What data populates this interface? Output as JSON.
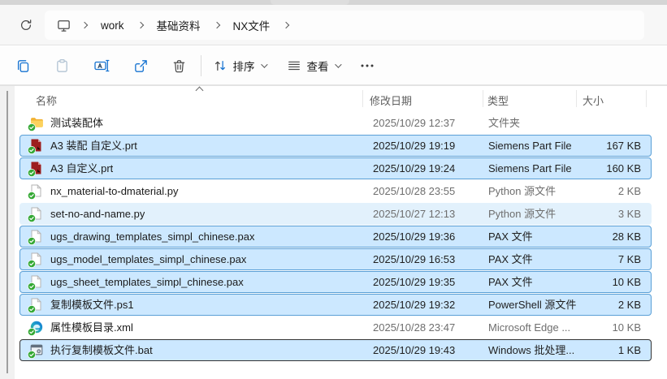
{
  "breadcrumb": {
    "items": [
      "work",
      "基础资料",
      "NX文件"
    ]
  },
  "toolbar": {
    "buttons": [
      "copy",
      "paste",
      "rename",
      "share",
      "delete"
    ],
    "sort_label": "排序",
    "view_label": "查看",
    "more_label": "more-options"
  },
  "columns": {
    "name": "名称",
    "date": "修改日期",
    "type": "类型",
    "size": "大小",
    "sort": "ascending-by-name"
  },
  "files": [
    {
      "name": "测试装配体",
      "date": "2025/10/29 12:37",
      "type": "文件夹",
      "size": "",
      "icon": "folder",
      "state": "none"
    },
    {
      "name": "A3 装配 自定义.prt",
      "date": "2025/10/29 19:19",
      "type": "Siemens Part File",
      "size": "167 KB",
      "icon": "prt",
      "state": "selected"
    },
    {
      "name": "A3 自定义.prt",
      "date": "2025/10/29 19:24",
      "type": "Siemens Part File",
      "size": "160 KB",
      "icon": "prt",
      "state": "selected"
    },
    {
      "name": "nx_material-to-dmaterial.py",
      "date": "2025/10/28 23:55",
      "type": "Python 源文件",
      "size": "2 KB",
      "icon": "file",
      "state": "none"
    },
    {
      "name": "set-no-and-name.py",
      "date": "2025/10/27 12:13",
      "type": "Python 源文件",
      "size": "3 KB",
      "icon": "file",
      "state": "hover"
    },
    {
      "name": "ugs_drawing_templates_simpl_chinese.pax",
      "date": "2025/10/29 19:36",
      "type": "PAX 文件",
      "size": "28 KB",
      "icon": "file",
      "state": "selected"
    },
    {
      "name": "ugs_model_templates_simpl_chinese.pax",
      "date": "2025/10/29 16:53",
      "type": "PAX 文件",
      "size": "7 KB",
      "icon": "file",
      "state": "selected"
    },
    {
      "name": "ugs_sheet_templates_simpl_chinese.pax",
      "date": "2025/10/29 19:35",
      "type": "PAX 文件",
      "size": "10 KB",
      "icon": "file",
      "state": "selected"
    },
    {
      "name": "复制模板文件.ps1",
      "date": "2025/10/29 19:32",
      "type": "PowerShell 源文件",
      "size": "2 KB",
      "icon": "file",
      "state": "selected"
    },
    {
      "name": "属性模板目录.xml",
      "date": "2025/10/28 23:47",
      "type": "Microsoft Edge ...",
      "size": "10 KB",
      "icon": "edge",
      "state": "none"
    },
    {
      "name": "执行复制模板文件.bat",
      "date": "2025/10/29 19:43",
      "type": "Windows 批处理...",
      "size": "1 KB",
      "icon": "bat",
      "state": "focused"
    }
  ],
  "icons": {
    "nav": [
      "refresh-icon",
      "this-pc-icon",
      "chevron-right-icon"
    ],
    "toolbar": [
      "copy-icon",
      "paste-icon",
      "rename-icon",
      "share-icon",
      "delete-icon",
      "sort-icon",
      "view-icon",
      "more-icon"
    ],
    "files": [
      "folder-icon",
      "prt-file-icon",
      "generic-file-icon",
      "edge-file-icon",
      "bat-file-icon",
      "sync-ok-icon"
    ]
  },
  "colors": {
    "accent": "#0078d4",
    "selection_fill": "#cce8ff",
    "selection_border": "#5a9fd6",
    "hover_fill": "#e2f1fc",
    "focus_border": "#333333",
    "sync_green": "#35a935",
    "secondary_text": "#6e6e6e"
  }
}
